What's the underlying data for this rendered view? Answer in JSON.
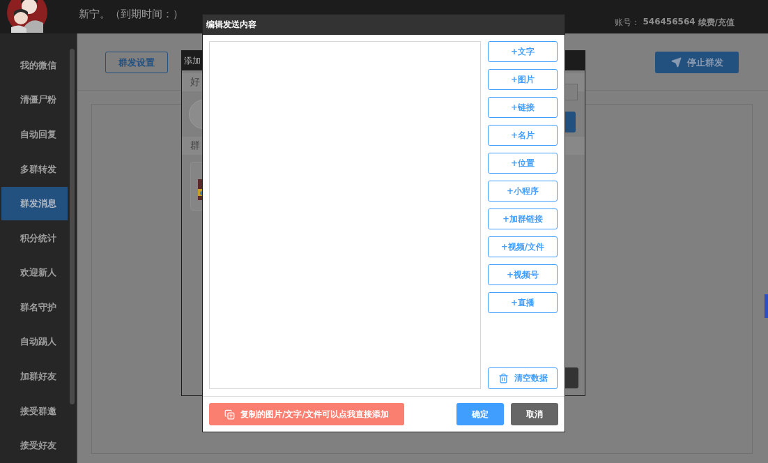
{
  "header": {
    "user_text": "新宁。（到期时间：）",
    "account_label": "账号：",
    "account_number": "546456564",
    "renew_link": "续费/充值"
  },
  "sidebar": {
    "items": [
      {
        "label": "我的微信",
        "selected": false
      },
      {
        "label": "清僵尸粉",
        "selected": false
      },
      {
        "label": "自动回复",
        "selected": false
      },
      {
        "label": "多群转发",
        "selected": false
      },
      {
        "label": "群发消息",
        "selected": true
      },
      {
        "label": "积分统计",
        "selected": false
      },
      {
        "label": "欢迎新人",
        "selected": false
      },
      {
        "label": "群名守护",
        "selected": false
      },
      {
        "label": "自动踢人",
        "selected": false
      },
      {
        "label": "加群好友",
        "selected": false
      },
      {
        "label": "接受群邀",
        "selected": false
      },
      {
        "label": "接受好友",
        "selected": false
      }
    ]
  },
  "toolbar": {
    "settings_button": "群发设置",
    "stop_button": "停止群发"
  },
  "background_dialog": {
    "title": "添加",
    "section_1": "好",
    "section_2": "群"
  },
  "dialog": {
    "title": "编辑发送内容",
    "add_buttons": [
      "+文字",
      "+图片",
      "+链接",
      "+名片",
      "+位置",
      "+小程序",
      "+加群链接",
      "+视频/文件",
      "+视频号",
      "+直播"
    ],
    "clear_button": "清空数据",
    "paste_button": "复制的图片/文字/文件可以点我直接添加",
    "confirm_button": "确定",
    "cancel_button": "取消"
  }
}
